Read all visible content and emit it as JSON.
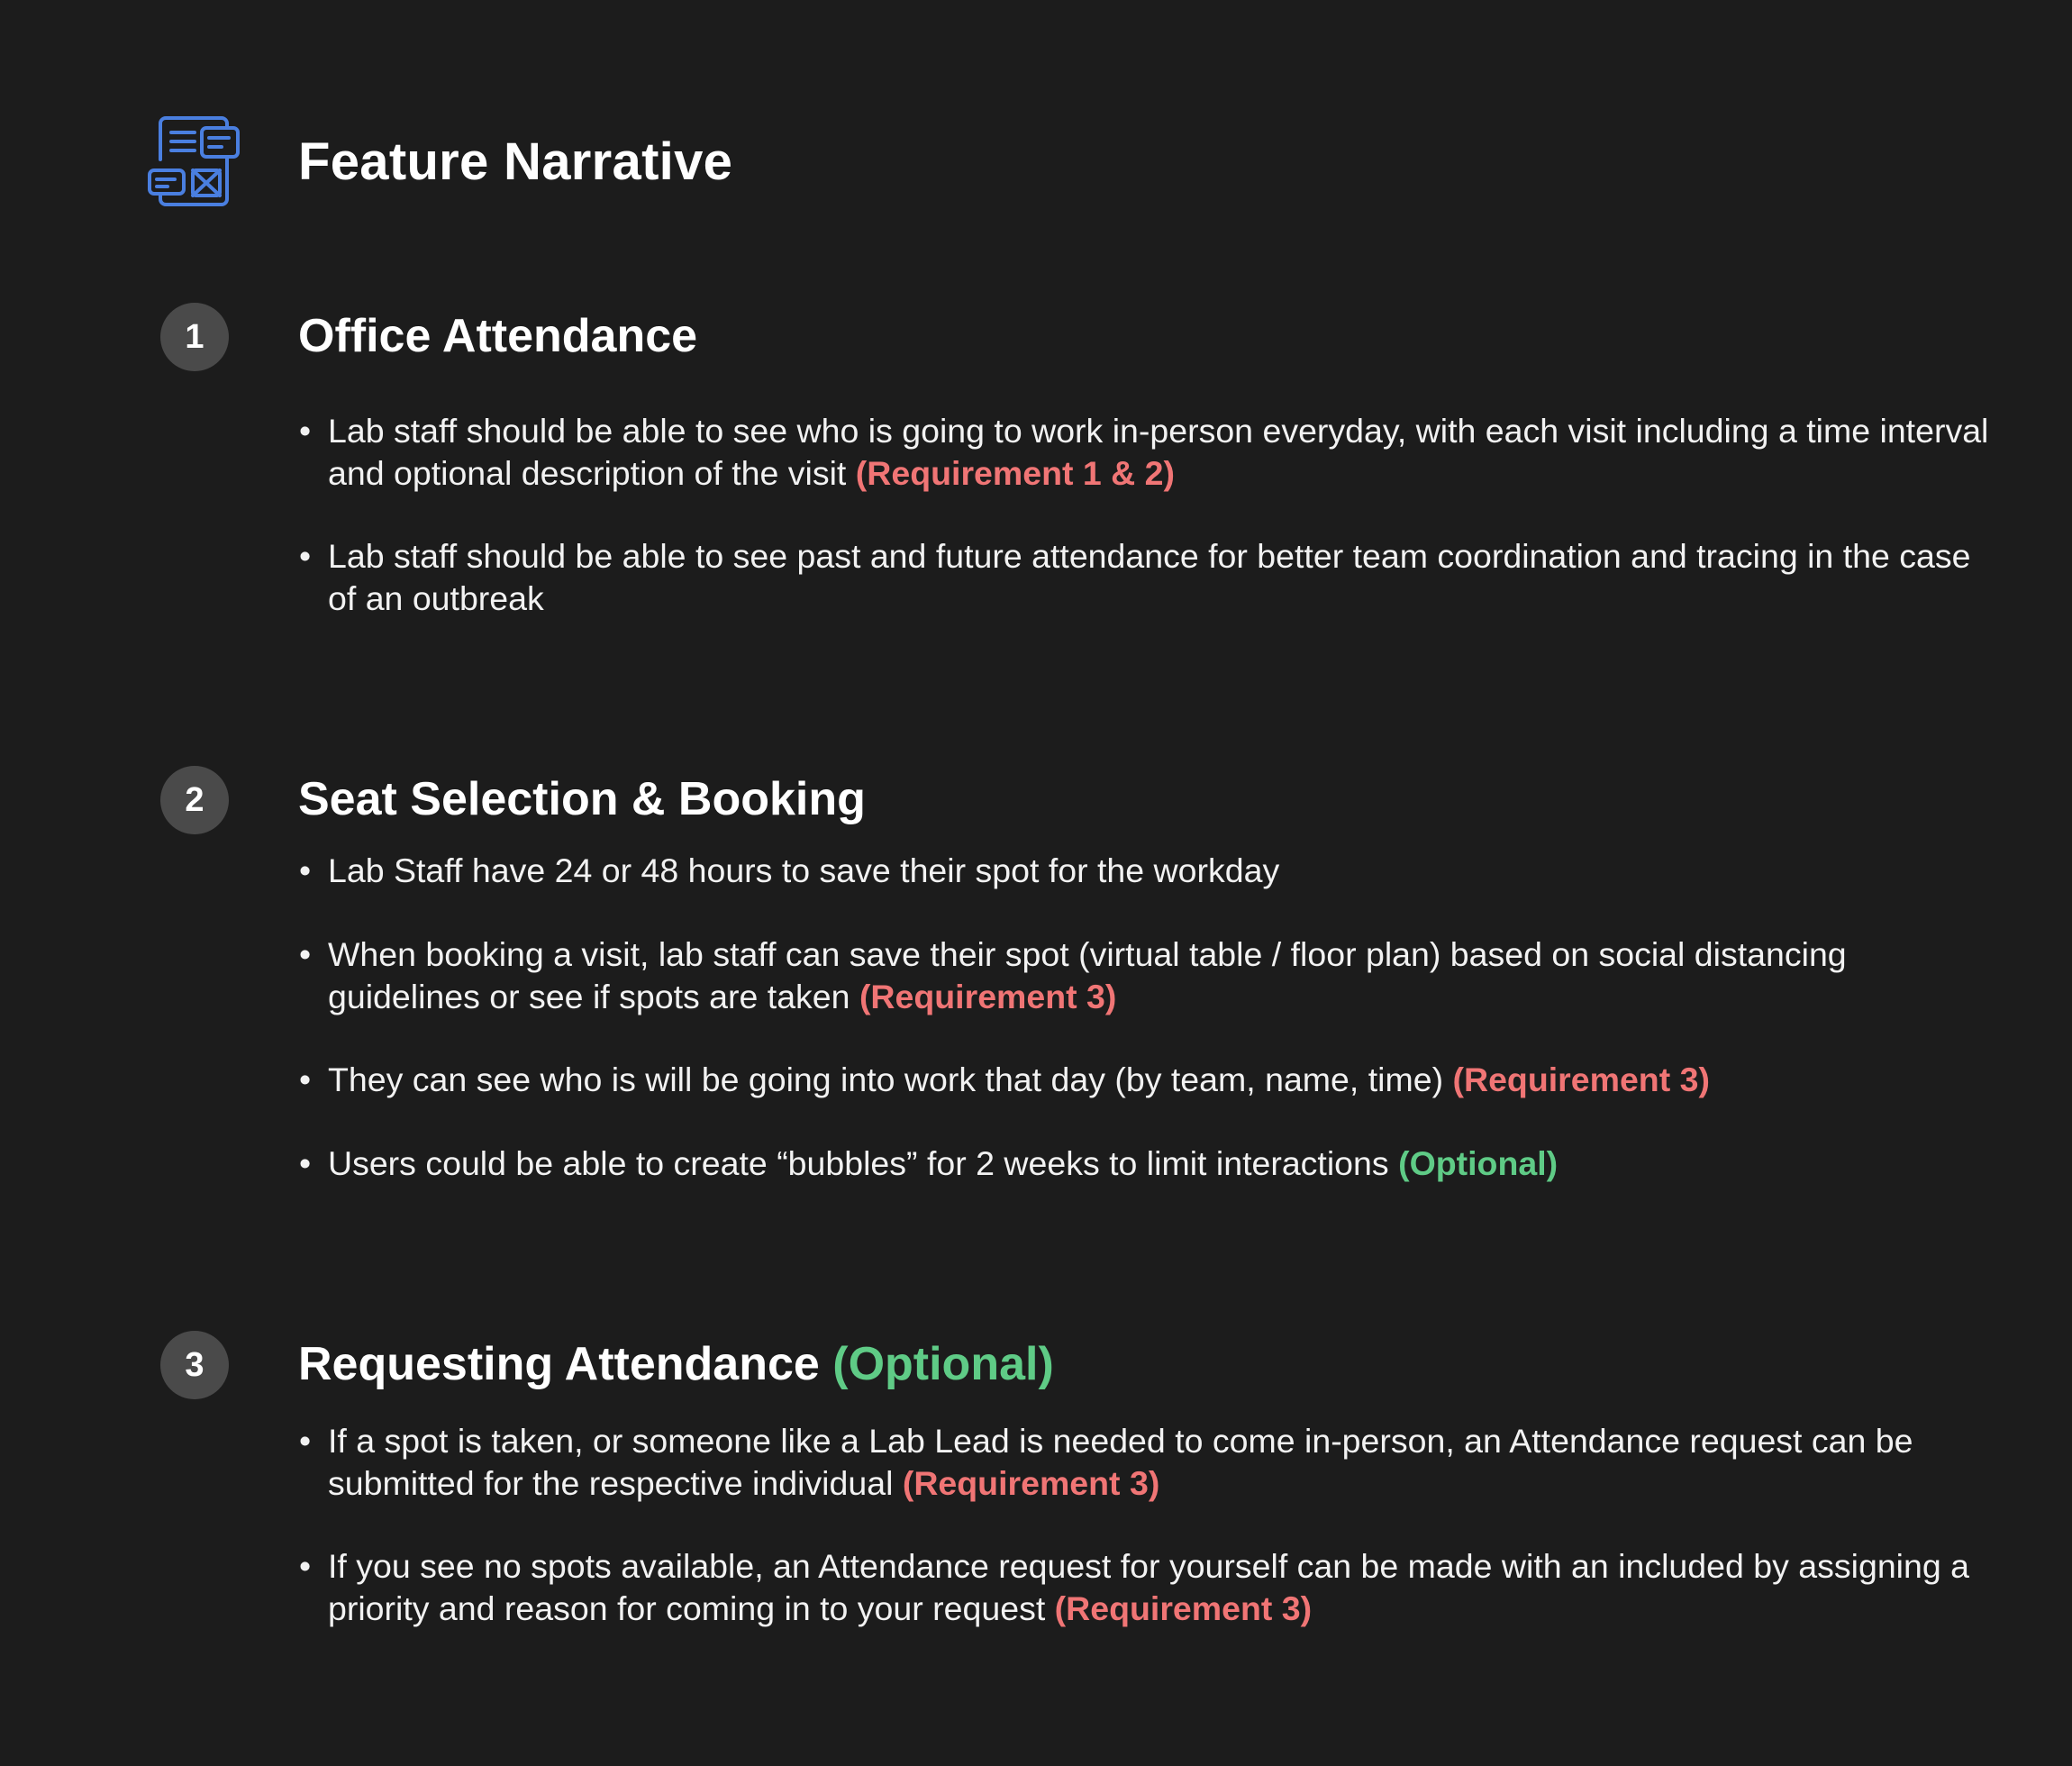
{
  "header": {
    "title": "Feature Narrative",
    "icon": "document-layout-icon",
    "icon_color": "#4a7fe0"
  },
  "colors": {
    "background": "#1c1c1c",
    "requirement": "#f07575",
    "optional": "#5fcb86",
    "badge": "#4a4a4a"
  },
  "sections": [
    {
      "number": "1",
      "title": "Office Attendance",
      "title_tag": "",
      "bullets": [
        {
          "text": "Lab staff should be able to see who is going to work in-person everyday, with each visit including a time interval and optional description of the visit",
          "tag": "(Requirement 1 & 2)",
          "tag_type": "requirement"
        },
        {
          "text": "Lab staff should be able to see past and future attendance for better team coordination and tracing in the case of an outbreak",
          "tag": "",
          "tag_type": ""
        }
      ]
    },
    {
      "number": "2",
      "title": "Seat Selection & Booking",
      "title_tag": "",
      "bullets": [
        {
          "text": "Lab Staff have 24 or 48 hours to save their spot for the workday",
          "tag": "",
          "tag_type": ""
        },
        {
          "text": "When booking a visit, lab staff can save their spot (virtual table / floor plan) based on social distancing guidelines or see if spots are taken",
          "tag": "(Requirement 3)",
          "tag_type": "requirement"
        },
        {
          "text": "They can see who is will be going into work that day (by team, name, time)",
          "tag": "(Requirement 3)",
          "tag_type": "requirement"
        },
        {
          "text": "Users could be able to create “bubbles” for 2 weeks to limit interactions",
          "tag": "(Optional)",
          "tag_type": "optional"
        }
      ]
    },
    {
      "number": "3",
      "title": "Requesting Attendance",
      "title_tag": "(Optional)",
      "bullets": [
        {
          "text": "If a spot is taken, or someone like a Lab Lead is needed to come in-person, an Attendance request can be submitted for the respective individual",
          "tag": "(Requirement 3)",
          "tag_type": "requirement"
        },
        {
          "text": "If you see no spots available, an Attendance request for yourself can be made with an included by assigning a priority and reason for coming in to your request",
          "tag": "(Requirement 3)",
          "tag_type": "requirement"
        }
      ]
    }
  ],
  "bullet_glyph": "•"
}
